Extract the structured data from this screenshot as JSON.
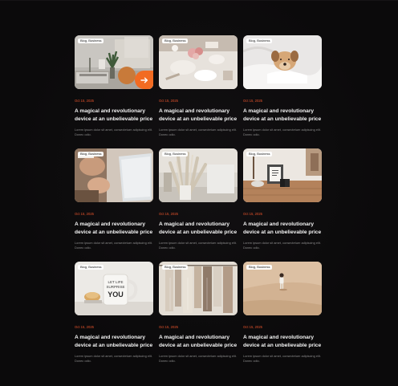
{
  "colors": {
    "background": "#0b0a0b",
    "accent": "#f26b22",
    "date": "#e8542c",
    "title": "#f4f4f4",
    "excerpt": "#8a8a8a"
  },
  "posts": [
    {
      "badge": "Blog, Business",
      "date": "Oct 15, 2025",
      "title": "A magical and revolutionary device at an unbelievable price",
      "excerpt": "Lorem ipsum dolor sit amet, consectetuer adipiscing elit. Donec odio.",
      "image": "desk-plant"
    },
    {
      "badge": "Blog, Business",
      "date": "Oct 15, 2025",
      "title": "A magical and revolutionary device at an unbelievable price",
      "excerpt": "Lorem ipsum dolor sit amet, consectetuer adipiscing elit. Donec odio.",
      "image": "dinner-table"
    },
    {
      "badge": "Blog, Business",
      "date": "Oct 15, 2025",
      "title": "A magical and revolutionary device at an unbelievable price",
      "excerpt": "Lorem ipsum dolor sit amet, consectetuer adipiscing elit. Donec odio.",
      "image": "dog-in-bed"
    },
    {
      "badge": "Blog, Business",
      "date": "Oct 15, 2025",
      "title": "A magical and revolutionary device at an unbelievable price",
      "excerpt": "Lorem ipsum dolor sit amet, consectetuer adipiscing elit. Donec odio.",
      "image": "hands-laptop"
    },
    {
      "badge": "Blog, Business",
      "date": "Oct 15, 2025",
      "title": "A magical and revolutionary device at an unbelievable price",
      "excerpt": "Lorem ipsum dolor sit amet, consectetuer adipiscing elit. Donec odio.",
      "image": "pampas-vase"
    },
    {
      "badge": "Blog, Business",
      "date": "Oct 15, 2025",
      "title": "A magical and revolutionary device at an unbelievable price",
      "excerpt": "Lorem ipsum dolor sit amet, consectetuer adipiscing elit. Donec odio.",
      "image": "wooden-shelf"
    },
    {
      "badge": "Blog, Business",
      "date": "Oct 15, 2025",
      "title": "A magical and revolutionary device at an unbelievable price",
      "excerpt": "Lorem ipsum dolor sit amet, consectetuer adipiscing elit. Donec odio.",
      "image": "coffee-mug",
      "mug_text": [
        "LET LIFE",
        "SURPRISE",
        "YOU"
      ]
    },
    {
      "badge": "Blog, Business",
      "date": "Oct 15, 2025",
      "title": "A magical and revolutionary device at an unbelievable price",
      "excerpt": "Lorem ipsum dolor sit amet, consectetuer adipiscing elit. Donec odio.",
      "image": "clothes-rack"
    },
    {
      "badge": "Blog, Business",
      "date": "Oct 15, 2025",
      "title": "A magical and revolutionary device at an unbelievable price",
      "excerpt": "Lorem ipsum dolor sit amet, consectetuer adipiscing elit. Donec odio.",
      "image": "desert-child"
    }
  ],
  "arrow_icon": "arrow-right-icon"
}
